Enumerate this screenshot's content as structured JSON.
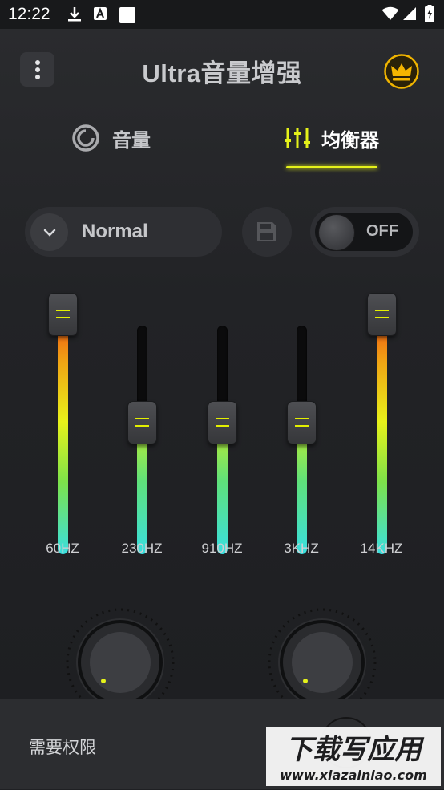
{
  "status_bar": {
    "time": "12:22",
    "icons": [
      "download-icon",
      "a-notification-icon",
      "square-notification-icon",
      "wifi-icon",
      "cell-signal-icon",
      "battery-charging-icon"
    ]
  },
  "header": {
    "title": "Ultra音量增强",
    "menu_icon": "more-vertical-icon",
    "premium_icon": "crown-icon"
  },
  "tabs": [
    {
      "label": "音量",
      "icon": "volume-ring-icon",
      "active": false
    },
    {
      "label": "均衡器",
      "icon": "equalizer-sliders-icon",
      "active": true
    }
  ],
  "controls": {
    "preset": "Normal",
    "save_icon": "save-icon",
    "toggle_label": "OFF",
    "toggle_on": false
  },
  "equalizer": {
    "bands": [
      {
        "label": "60HZ",
        "level": 1.0
      },
      {
        "label": "230HZ",
        "level": 0.5
      },
      {
        "label": "910HZ",
        "level": 0.5
      },
      {
        "label": "3KHZ",
        "level": 0.5
      },
      {
        "label": "14KHZ",
        "level": 1.0
      }
    ]
  },
  "knobs": [
    {
      "name": "bass-boost-knob"
    },
    {
      "name": "virtualizer-knob"
    }
  ],
  "bottom_sheet": {
    "permission_label": "需要权限"
  },
  "watermark": {
    "title": "下载写应用",
    "url": "www.xiazainiao.com"
  },
  "colors": {
    "accent": "#e5f21a",
    "background": "#1f2023",
    "fill_bottom": "#39dfe0",
    "fill_top": "#f24a12"
  }
}
